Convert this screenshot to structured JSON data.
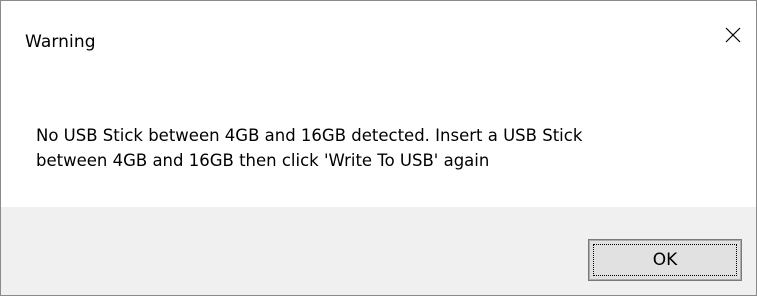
{
  "window": {
    "title": "Warning",
    "close_icon": "close-icon"
  },
  "message": {
    "text": "No USB Stick between 4GB and 16GB detected. Insert a USB Stick\nbetween 4GB and 16GB then click 'Write To USB' again"
  },
  "buttons": {
    "ok_label": "OK"
  },
  "colors": {
    "footer_bg": "#f0f0f0",
    "button_bg": "#e1e1e1",
    "button_border": "#adadad"
  }
}
